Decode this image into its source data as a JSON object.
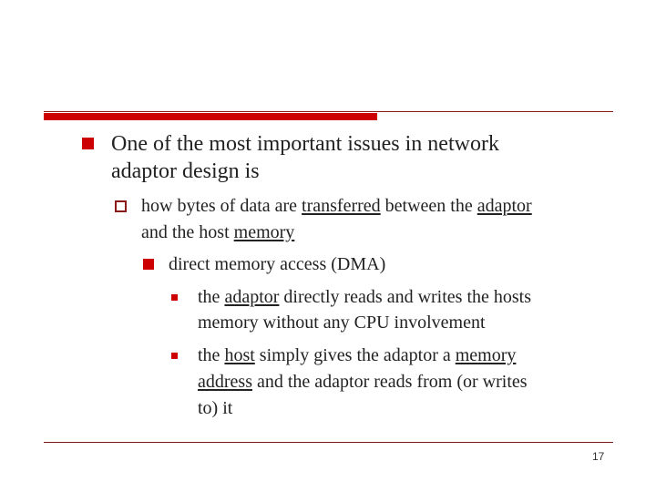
{
  "slide": {
    "page_number": "17",
    "accent_color": "#cc0000",
    "bullets": [
      {
        "level": 1,
        "icon": "filled-square",
        "lines": [
          "One of the most important issues in network",
          "adaptor design is"
        ]
      },
      {
        "level": 2,
        "icon": "hollow-square",
        "lines": [
          [
            {
              "t": "how bytes of data are "
            },
            {
              "t": "transferred",
              "u": true
            },
            {
              "t": " between the "
            },
            {
              "t": "adaptor",
              "u": true
            }
          ],
          [
            {
              "t": "and the host "
            },
            {
              "t": "memory",
              "u": true
            }
          ]
        ]
      },
      {
        "level": 3,
        "icon": "filled-square",
        "lines": [
          "direct memory access (DMA)"
        ]
      },
      {
        "level": 4,
        "icon": "small-square",
        "lines": [
          [
            {
              "t": "the "
            },
            {
              "t": "adaptor",
              "u": true
            },
            {
              "t": " directly reads and writes the hosts"
            }
          ],
          [
            {
              "t": "memory without any CPU involvement"
            }
          ]
        ]
      },
      {
        "level": 4,
        "icon": "small-square",
        "lines": [
          [
            {
              "t": "the "
            },
            {
              "t": "host",
              "u": true
            },
            {
              "t": " simply gives the adaptor a "
            },
            {
              "t": "memory",
              "u": true
            }
          ],
          [
            {
              "t": "address",
              "u": true
            },
            {
              "t": " and the adaptor reads from (or writes"
            }
          ],
          [
            {
              "t": "to) it"
            }
          ]
        ]
      }
    ]
  },
  "text": {
    "b1l1": "One of the most important issues in network",
    "b1l2": "adaptor design is",
    "b2l1a": "how bytes of data are ",
    "b2l1b": "transferred",
    "b2l1c": " between the ",
    "b2l1d": "adaptor",
    "b2l2a": "and the host ",
    "b2l2b": "memory",
    "b3l1": "direct memory access (DMA)",
    "b4l1a": "the ",
    "b4l1b": "adaptor",
    "b4l1c": " directly reads and writes the hosts",
    "b4l2": "memory without any CPU involvement",
    "b5l1a": "the ",
    "b5l1b": "host",
    "b5l1c": " simply gives the adaptor a ",
    "b5l1d": "memory",
    "b5l2a": "address",
    "b5l2b": " and the adaptor reads from (or writes",
    "b5l3": "to) it",
    "page": "17"
  }
}
